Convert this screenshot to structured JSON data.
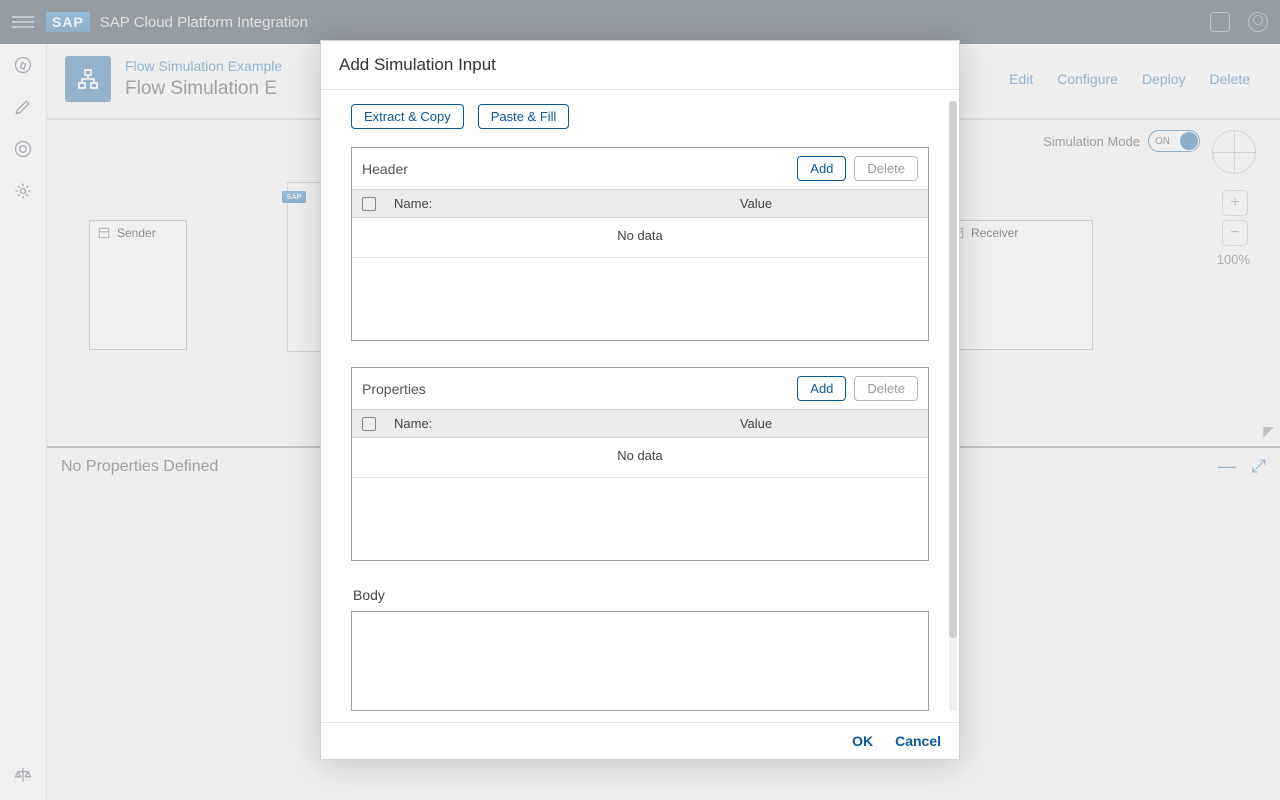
{
  "header": {
    "app_title": "SAP Cloud Platform Integration"
  },
  "breadcrumb": {
    "link": "Flow Simulation Example",
    "title": "Flow Simulation E"
  },
  "actions": {
    "edit": "Edit",
    "configure": "Configure",
    "deploy": "Deploy",
    "delete": "Delete"
  },
  "sim": {
    "label": "Simulation Mode",
    "state": "ON",
    "zoom": "100%"
  },
  "canvas": {
    "sender": "Sender",
    "receiver": "Receiver"
  },
  "props_bar": {
    "text": "No Properties Defined"
  },
  "dialog": {
    "title": "Add Simulation Input",
    "extract": "Extract & Copy",
    "paste": "Paste & Fill",
    "sections": {
      "header": {
        "title": "Header",
        "add": "Add",
        "delete": "Delete",
        "name": "Name:",
        "value": "Value",
        "nodata": "No data"
      },
      "props": {
        "title": "Properties",
        "add": "Add",
        "delete": "Delete",
        "name": "Name:",
        "value": "Value",
        "nodata": "No data"
      }
    },
    "body_label": "Body",
    "ok": "OK",
    "cancel": "Cancel"
  }
}
